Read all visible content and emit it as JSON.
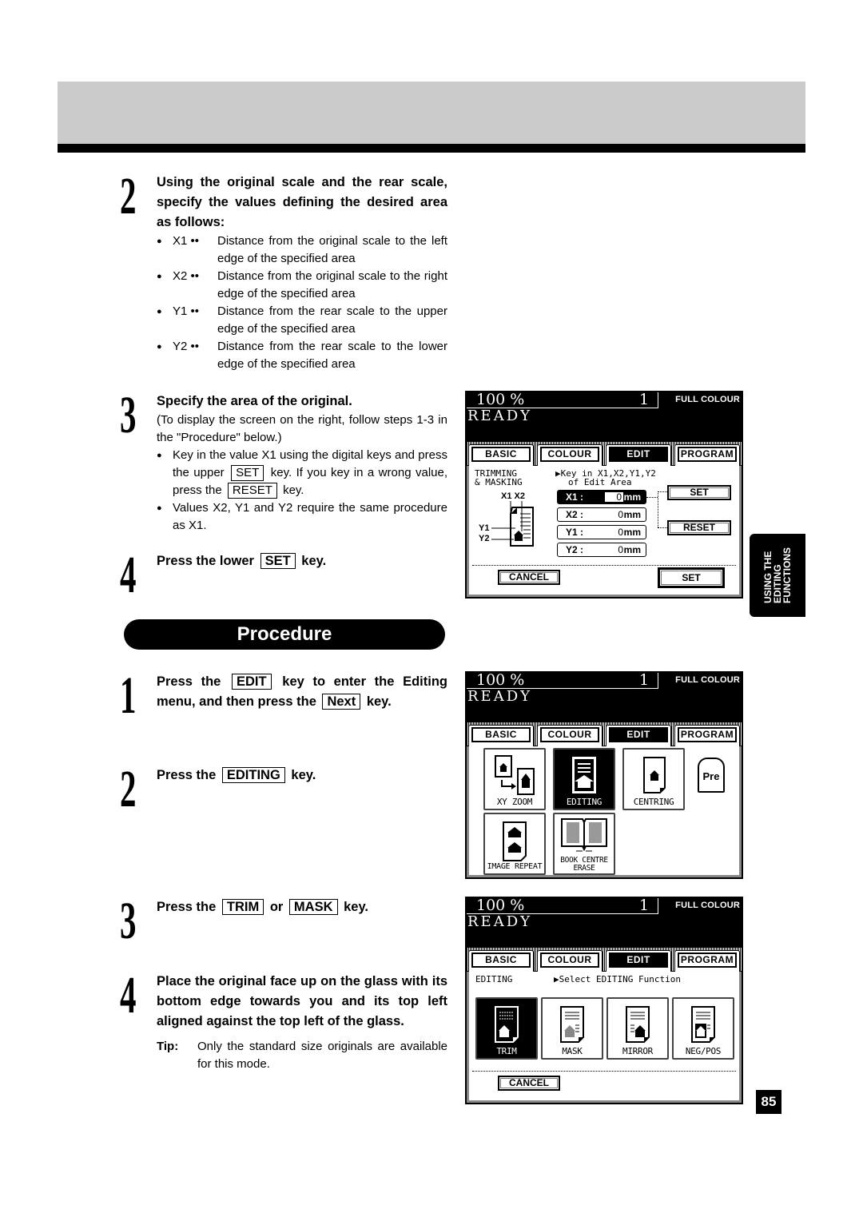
{
  "steps_top": [
    {
      "number": "2",
      "title": "Using the original scale and the rear scale, specify the values defining the desired area as follows:",
      "definitions": [
        {
          "key": "X1 ••",
          "text": "Distance from the original scale to the left edge of the specified area"
        },
        {
          "key": "X2 ••",
          "text": "Distance from the original scale to the right edge of the specified area"
        },
        {
          "key": "Y1 ••",
          "text": "Distance from the rear scale to the upper edge of the specified area"
        },
        {
          "key": "Y2 ••",
          "text": "Distance from the rear scale to the lower edge of the specified area"
        }
      ]
    },
    {
      "number": "3",
      "title": "Specify the area of the original.",
      "note": "(To display the screen on the right, follow steps 1-3 in the \"Procedure\" below.)",
      "bullet1_a": "Key in the value X1 using the digital keys and press the upper",
      "bullet1_key1": "SET",
      "bullet1_b": "key.  If you key in a wrong value, press the",
      "bullet1_key2": "RESET",
      "bullet1_c": "key.",
      "bullet2": "Values X2, Y1 and Y2 require the same procedure as X1."
    },
    {
      "number": "4",
      "title_a": "Press the lower",
      "title_key": "SET",
      "title_b": "key."
    }
  ],
  "procedure": {
    "banner": "Procedure",
    "steps": [
      {
        "number": "1",
        "a": "Press the",
        "key1": "EDIT",
        "b": "key to enter the Editing menu, and then press the",
        "key2": "Next",
        "c": "key."
      },
      {
        "number": "2",
        "a": "Press the",
        "key1": "EDITING",
        "b": "key."
      },
      {
        "number": "3",
        "a": "Press the",
        "key1": "TRIM",
        "b": "or",
        "key2": "MASK",
        "c": "key."
      },
      {
        "number": "4",
        "title": "Place the original face up on the glass with its bottom edge towards you and its top left aligned against the top left of the glass.",
        "tip_label": "Tip:",
        "tip_text": "Only the standard size originals are available for this mode."
      }
    ]
  },
  "side_tab": {
    "line1": "USING THE",
    "line2": "EDITING",
    "line3": "FUNCTIONS"
  },
  "page_number": "85",
  "lcd_common": {
    "ratio": "100 %",
    "count": "1",
    "mode": "FULL COLOUR",
    "status": "READY",
    "tabs": [
      "BASIC",
      "COLOUR",
      "EDIT",
      "PROGRAM"
    ],
    "active_tab": "EDIT"
  },
  "screen1": {
    "caption_left_1": "TRIMMING",
    "caption_left_2": "& MASKING",
    "caption_right_1": "▶Key in X1,X2,Y1,Y2",
    "caption_right_2": "of Edit Area",
    "diagram_labels": {
      "x1x2": "X1 X2",
      "y1": "Y1",
      "y2": "Y2"
    },
    "fields": [
      {
        "label": "X1 :",
        "value": "0",
        "unit": "mm",
        "active": true
      },
      {
        "label": "X2 :",
        "value": "0",
        "unit": "mm",
        "active": false
      },
      {
        "label": "Y1 :",
        "value": "0",
        "unit": "mm",
        "active": false
      },
      {
        "label": "Y2 :",
        "value": "0",
        "unit": "mm",
        "active": false
      }
    ],
    "set_upper": "SET",
    "reset": "RESET",
    "cancel": "CANCEL",
    "set_lower": "SET"
  },
  "screen2": {
    "buttons": [
      {
        "label": "XY ZOOM",
        "active": false
      },
      {
        "label": "EDITING",
        "active": true
      },
      {
        "label": "CENTRING",
        "active": false
      },
      {
        "label": "IMAGE REPEAT",
        "active": false
      },
      {
        "label": "BOOK CENTRE ERASE",
        "active": false
      }
    ],
    "pre_label": "Pre"
  },
  "screen3": {
    "caption_left": "EDITING",
    "caption_right": "▶Select EDITING Function",
    "buttons": [
      {
        "label": "TRIM",
        "active": true
      },
      {
        "label": "MASK",
        "active": false
      },
      {
        "label": "MIRROR",
        "active": false
      },
      {
        "label": "NEG/POS",
        "active": false
      }
    ],
    "cancel": "CANCEL"
  }
}
